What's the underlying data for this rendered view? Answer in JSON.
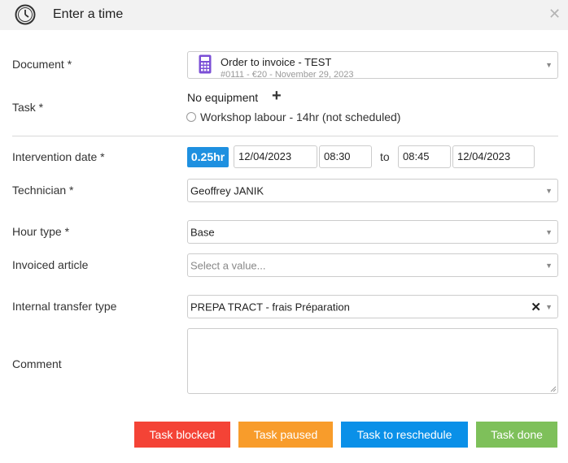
{
  "header": {
    "title": "Enter a time"
  },
  "labels": {
    "document": "Document *",
    "task": "Task *",
    "intervention_date": "Intervention date *",
    "technician": "Technician *",
    "hour_type": "Hour type *",
    "invoiced_article": "Invoiced article",
    "internal_transfer_type": "Internal transfer type",
    "comment": "Comment"
  },
  "document": {
    "title": "Order to invoice - TEST",
    "subtitle": "#0111 - €20 - November 29, 2023"
  },
  "task": {
    "equipment": "No equipment",
    "option": "Workshop labour - 14hr (not scheduled)"
  },
  "intervention": {
    "duration": "0.25hr",
    "start_date": "12/04/2023",
    "start_time": "08:30",
    "to_label": "to",
    "end_time": "08:45",
    "end_date": "12/04/2023"
  },
  "technician": {
    "value": "Geoffrey JANIK"
  },
  "hour_type": {
    "value": "Base"
  },
  "invoiced_article": {
    "placeholder": "Select a value..."
  },
  "internal_transfer": {
    "value": "PREPA TRACT - frais Préparation"
  },
  "comment": {
    "value": ""
  },
  "buttons": {
    "blocked": "Task blocked",
    "paused": "Task paused",
    "reschedule": "Task to reschedule",
    "done": "Task done"
  },
  "icons": {
    "header": "clock-icon",
    "close": "close-icon",
    "document": "calculator-icon",
    "add": "plus-icon",
    "dropdown": "chevron-down-icon",
    "clear": "clear-icon"
  },
  "colors": {
    "blocked": "#f44336",
    "paused": "#f89c2b",
    "reschedule": "#0a90e8",
    "done": "#7ec05a",
    "duration_badge": "#1e90e0",
    "calculator": "#7b4fd6"
  }
}
